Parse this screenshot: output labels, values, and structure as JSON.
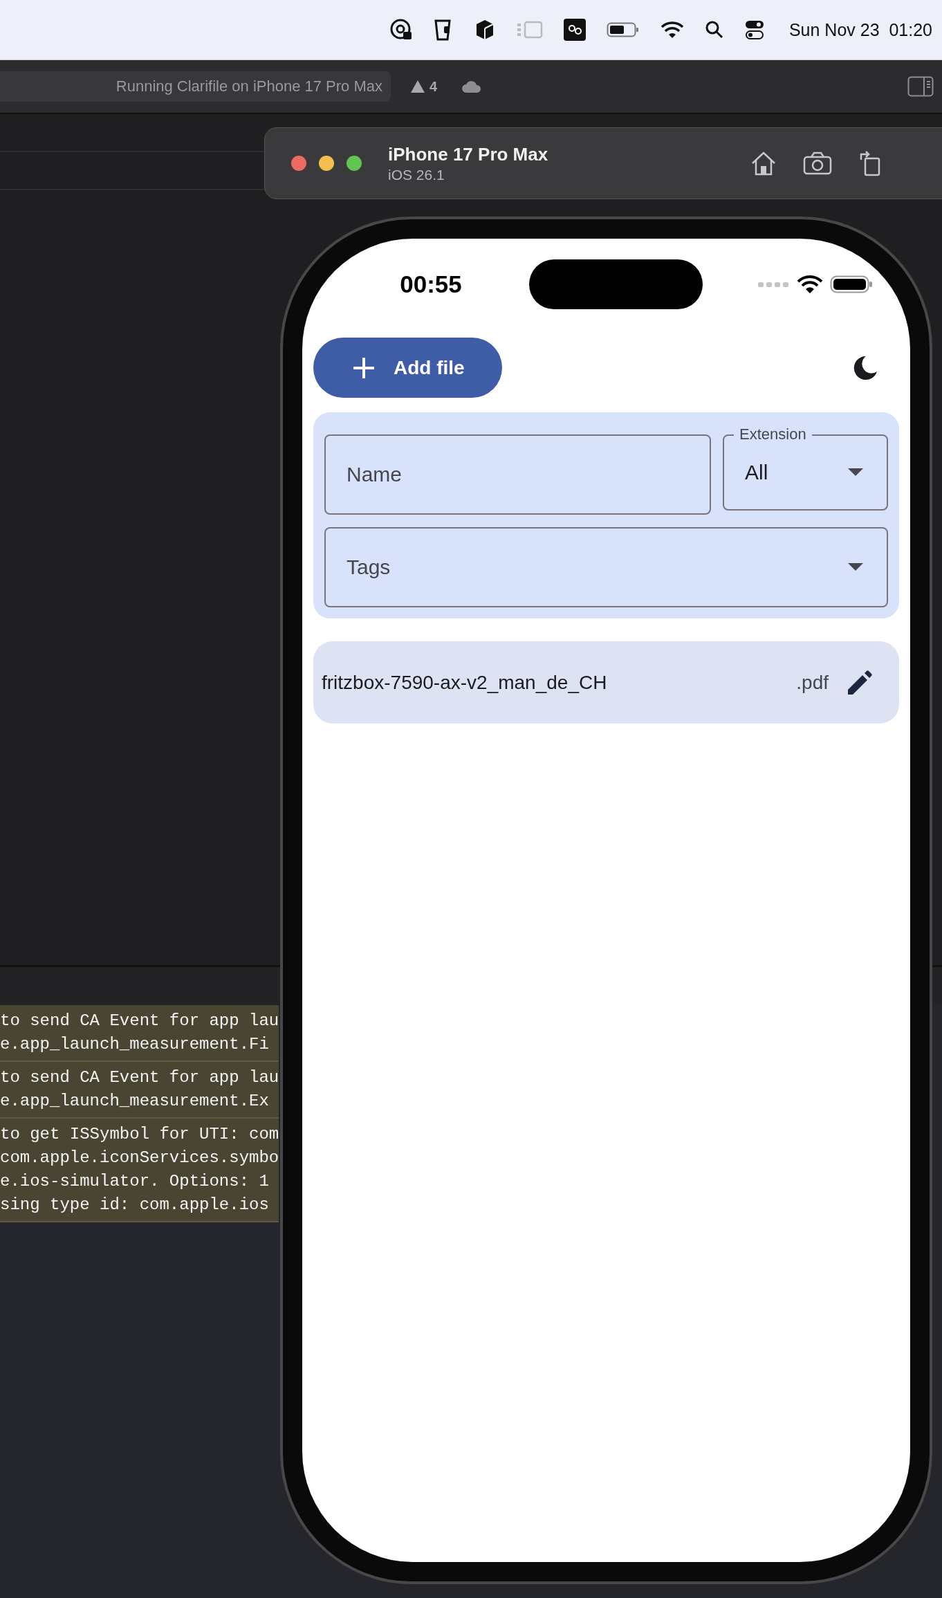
{
  "menu_bar": {
    "clock": "Sun Nov 23  01:20"
  },
  "toolbar": {
    "activity": "Running Clarifile on iPhone 17 Pro Max",
    "warning_count": "4"
  },
  "console": {
    "entries": [
      {
        "lines": [
          "to send CA Event for app lau",
          "e.app_launch_measurement.Fi"
        ]
      },
      {
        "lines": [
          "to send CA Event for app lau",
          "e.app_launch_measurement.Ex"
        ]
      },
      {
        "lines": [
          "to get ISSymbol for UTI: com",
          "com.apple.iconServices.symbo",
          "e.ios-simulator. Options: 1",
          "sing type id: com.apple.ios"
        ]
      }
    ]
  },
  "simulator": {
    "title": "iPhone 17 Pro Max",
    "subtitle": "iOS 26.1"
  },
  "phone": {
    "status_time": "00:55",
    "add_button": "Add file",
    "filters": {
      "name": {
        "placeholder": "Name"
      },
      "extension": {
        "label": "Extension",
        "value": "All"
      },
      "tags": {
        "placeholder": "Tags"
      }
    },
    "files": [
      {
        "name": "fritzbox-7590-ax-v2_man_de_CH",
        "extension": ".pdf"
      }
    ]
  }
}
